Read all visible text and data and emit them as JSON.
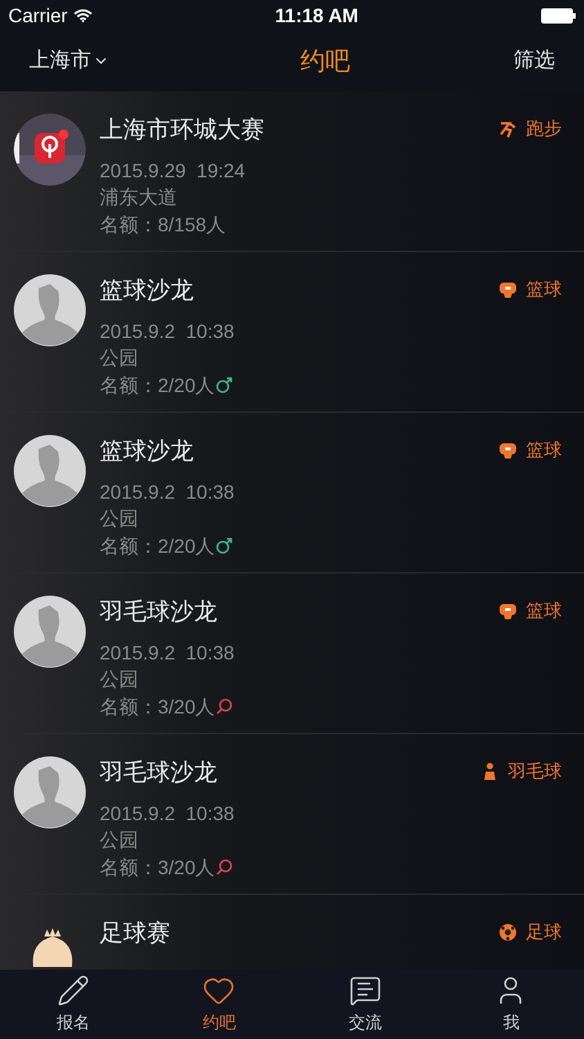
{
  "status_bar": {
    "carrier": "Carrier",
    "time": "11:18 AM"
  },
  "nav": {
    "city": "上海市",
    "title": "约吧",
    "filter": "筛选"
  },
  "events": [
    {
      "title": "上海市环城大赛",
      "datetime": "2015.9.29  19:24",
      "place": "浦东大道",
      "quota": {
        "text": "名额：8/158人"
      },
      "tag": {
        "kind": "running",
        "label": "跑步"
      }
    },
    {
      "avatar": {
        "kind": "default"
      },
      "title": "篮球沙龙",
      "datetime": "2015.9.2  10:38",
      "place": "公园",
      "quota": {
        "text": "名额：2/20人",
        "kind": "male"
      },
      "tag": {
        "kind": "basketball",
        "label": "篮球"
      }
    },
    {
      "avatar": {
        "kind": "default"
      },
      "title": "篮球沙龙",
      "datetime": "2015.9.2  10:38",
      "place": "公园",
      "quota": {
        "text": "名额：2/20人",
        "kind": "male"
      },
      "tag": {
        "kind": "basketball",
        "label": "篮球"
      }
    },
    {
      "avatar": {
        "kind": "default"
      },
      "title": "羽毛球沙龙",
      "datetime": "2015.9.2  10:38",
      "place": "公园",
      "quota": {
        "text": "名额：3/20人",
        "kind": "female"
      },
      "tag": {
        "kind": "basketball",
        "label": "篮球"
      }
    },
    {
      "avatar": {
        "kind": "default"
      },
      "title": "羽毛球沙龙",
      "datetime": "2015.9.2  10:38",
      "place": "公园",
      "quota": {
        "text": "名额：3/20人",
        "kind": "female"
      },
      "tag": {
        "kind": "badminton",
        "label": "羽毛球"
      }
    },
    {
      "avatar": {
        "kind": "cartoon"
      },
      "title": "足球赛",
      "tag": {
        "kind": "football",
        "label": "足球"
      }
    }
  ],
  "tabs": [
    {
      "label": "报名",
      "selected": false
    },
    {
      "label": "约吧",
      "selected": true
    },
    {
      "label": "交流",
      "selected": false
    },
    {
      "label": "我",
      "selected": false
    }
  ]
}
